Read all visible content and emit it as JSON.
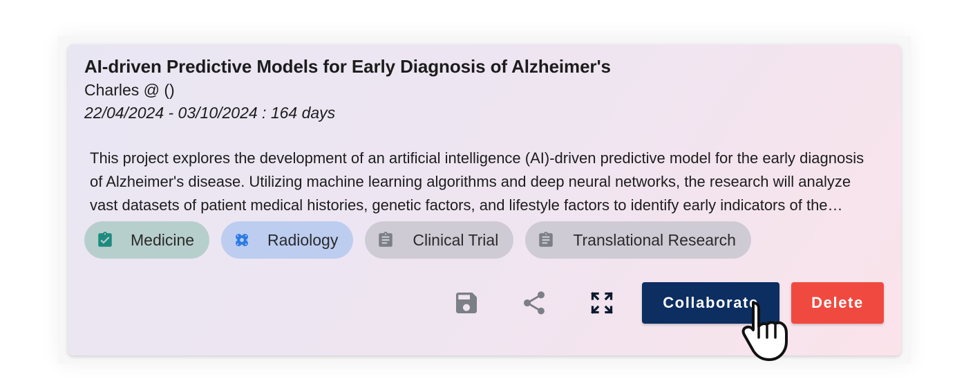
{
  "project": {
    "title": "AI-driven Predictive Models for Early Diagnosis of Alzheimer's",
    "author": "Charles @ ()",
    "dates": "22/04/2024 - 03/10/2024 : 164 days",
    "description": "This project explores the development of an artificial intelligence (AI)-driven predictive model for the early diagnosis of Alzheimer's disease. Utilizing machine learning algorithms and deep neural networks, the research will analyze vast datasets of patient medical histories, genetic factors, and lifestyle factors to identify early indicators of the disease."
  },
  "tags": [
    {
      "label": "Medicine",
      "icon": "clipboard-check-icon",
      "color": "#1f8b7f"
    },
    {
      "label": "Radiology",
      "icon": "bandage-icon",
      "color": "#2c7be5"
    },
    {
      "label": "Clinical Trial",
      "icon": "clipboard-icon",
      "color": "#7b7f87"
    },
    {
      "label": "Translational Research",
      "icon": "clipboard-icon",
      "color": "#7b7f87"
    }
  ],
  "actions": {
    "save_icon": "save-icon",
    "share_icon": "share-icon",
    "expand_icon": "fullscreen-icon",
    "collaborate_label": "Collaborate",
    "delete_label": "Delete"
  },
  "colors": {
    "collaborate": "#0c2e61",
    "delete": "#f04a40",
    "icon_gray": "#7b7f87"
  }
}
